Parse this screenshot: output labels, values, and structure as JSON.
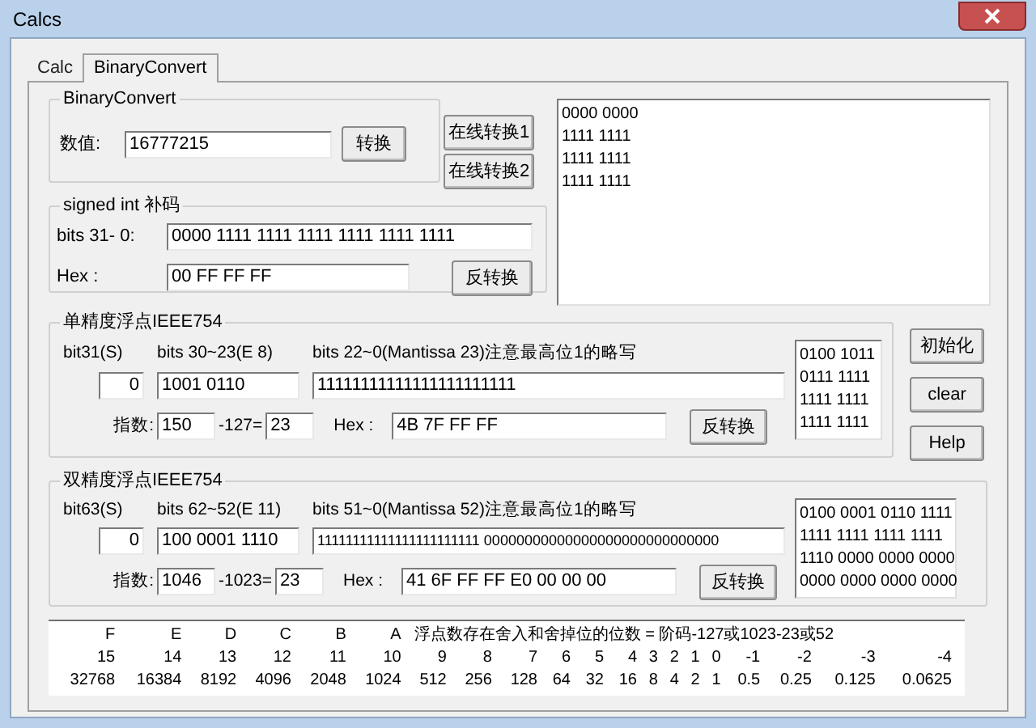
{
  "window": {
    "title": "Calcs"
  },
  "tabs": [
    {
      "label": "Calc",
      "selected": false
    },
    {
      "label": "BinaryConvert",
      "selected": true
    }
  ],
  "binary_convert": {
    "title": "BinaryConvert",
    "value_label": "数值:",
    "value": "16777215",
    "convert_button": "转换",
    "online_buttons": [
      "在线转换1",
      "在线转换2"
    ]
  },
  "signed_int": {
    "title": "signed int 补码",
    "bits_label": "bits 31- 0:",
    "bits_value": "0000 1111 1111 1111 1111 1111 1111",
    "hex_label": "Hex :",
    "hex_value": "00 FF FF FF",
    "reverse_button": "反转换"
  },
  "output_lines": [
    "0000 0000",
    "1111 1111",
    "1111 1111",
    "1111 1111"
  ],
  "single": {
    "title": "单精度浮点IEEE754",
    "headers": [
      "bit31(S)",
      "bits 30~23(E 8)",
      "bits 22~0(Mantissa 23)注意最高位1的略写"
    ],
    "sign": "0",
    "exponent_bits": "1001 0110",
    "mantissa": "11111111111111111111111",
    "exponent_label": "指数:",
    "exponent": "150",
    "bias_label": "-127=",
    "exponent_result": "23",
    "hex_label": "Hex :",
    "hex_value": "4B 7F FF FF",
    "reverse_button": "反转换",
    "binary_lines": [
      "0100 1011",
      "0111 1111",
      "1111 1111",
      "1111 1111"
    ]
  },
  "side_buttons": [
    "初始化",
    "clear",
    "Help"
  ],
  "double": {
    "title": "双精度浮点IEEE754",
    "headers": [
      "bit63(S)",
      "bits 62~52(E 11)",
      "bits 51~0(Mantissa 52)注意最高位1的略写"
    ],
    "sign": "0",
    "exponent_bits": "100 0001 1110",
    "mantissa": "11111111111111111111111 00000000000000000000000000000",
    "exponent_label": "指数:",
    "exponent": "1046",
    "bias_label": "-1023=",
    "exponent_result": "23",
    "hex_label": "Hex :",
    "hex_value": "41 6F FF FF E0 00 00 00",
    "reverse_button": "反转换",
    "binary_lines": [
      "0100 0001 0110 1111",
      "1111 1111 1111 1111",
      "1110 0000 0000 0000",
      "0000 0000 0000 0000"
    ]
  },
  "table": {
    "hex_digits": [
      "F",
      "E",
      "D",
      "C",
      "B",
      "A"
    ],
    "note": "浮点数存在舍入和舍掉位的位数 = 阶码-127或1023-23或52",
    "positions": [
      "15",
      "14",
      "13",
      "12",
      "11",
      "10",
      "9",
      "8",
      "7",
      "6",
      "5",
      "4",
      "3",
      "2",
      "1",
      "0",
      "-1",
      "-2",
      "-3",
      "-4"
    ],
    "values": [
      "32768",
      "16384",
      "8192",
      "4096",
      "2048",
      "1024",
      "512",
      "256",
      "128",
      "64",
      "32",
      "16",
      "8",
      "4",
      "2",
      "1",
      "0.5",
      "0.25",
      "0.125",
      "0.0625"
    ]
  }
}
